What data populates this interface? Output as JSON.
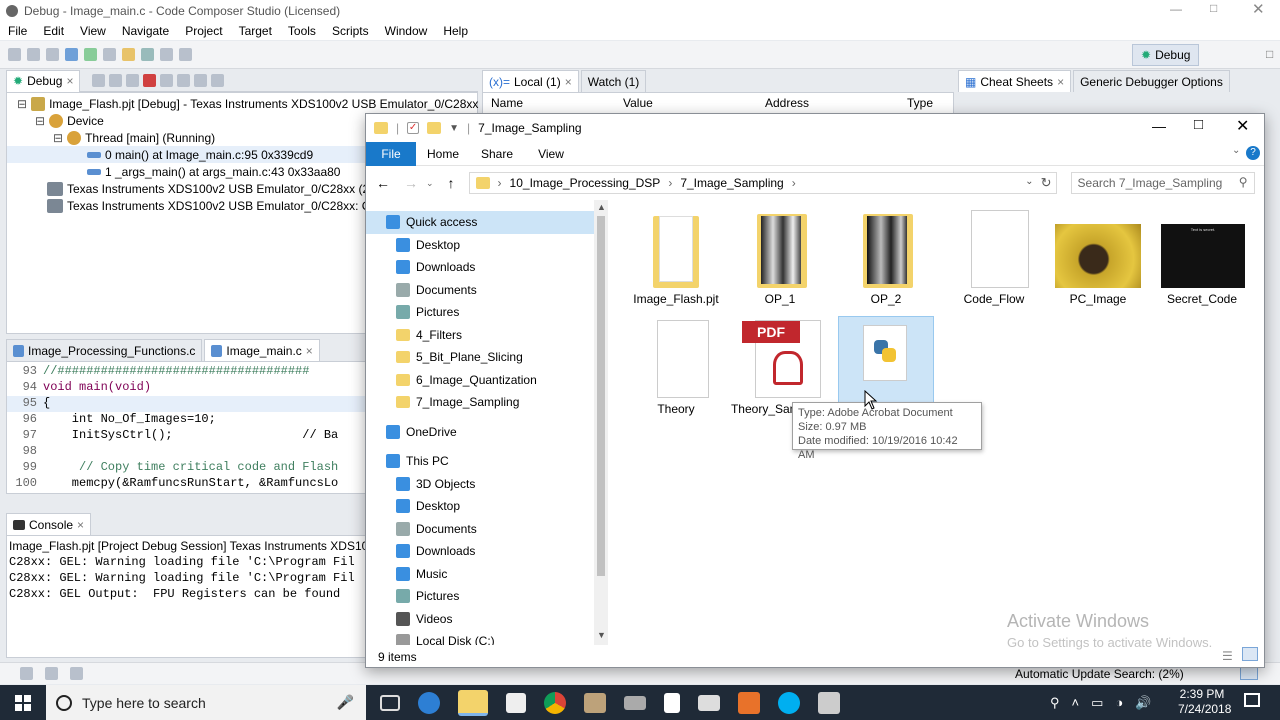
{
  "ccs": {
    "title": "Debug - Image_main.c - Code Composer Studio (Licensed)",
    "menu": [
      "File",
      "Edit",
      "View",
      "Navigate",
      "Project",
      "Target",
      "Tools",
      "Scripts",
      "Window",
      "Help"
    ],
    "perspective": "Debug",
    "debug_view": {
      "tab": "Debug",
      "tree": [
        "Image_Flash.pjt [Debug] - Texas Instruments XDS100v2 USB Emulator_0/C28xx [Project",
        "Device",
        "Thread [main] (Running)",
        "0 main() at Image_main.c:95 0x339cd9",
        "1 _args_main() at args_main.c:43 0x33aa80",
        "Texas Instruments XDS100v2 USB Emulator_0/C28xx (2:38:26 I",
        "Texas Instruments XDS100v2 USB Emulator_0/C28xx: CIO (2:3"
      ]
    },
    "variables_view": {
      "tabs": [
        "Local (1)",
        "Watch (1)"
      ],
      "columns": [
        "Name",
        "Value",
        "Address",
        "Type"
      ]
    },
    "right_view": {
      "tabs": [
        "Cheat Sheets",
        "Generic Debugger Options"
      ]
    },
    "editor": {
      "tabs": [
        "Image_Processing_Functions.c",
        "Image_main.c"
      ],
      "lines": [
        {
          "num": "93",
          "text": "//###################################"
        },
        {
          "num": "94",
          "text": "void main(void)"
        },
        {
          "num": "95",
          "text": "{"
        },
        {
          "num": "96",
          "text": "    int No_Of_Images=10;"
        },
        {
          "num": "97",
          "text": "    InitSysCtrl();                  // Ba"
        },
        {
          "num": "98",
          "text": ""
        },
        {
          "num": "99",
          "text": "     // Copy time critical code and Flash"
        },
        {
          "num": "100",
          "text": "    memcpy(&RamfuncsRunStart, &RamfuncsLo"
        }
      ]
    },
    "console": {
      "tab": "Console",
      "lines": [
        "Image_Flash.pjt [Project Debug Session] Texas Instruments XDS100v2 USB",
        "C28xx: GEL: Warning loading file 'C:\\Program Fil",
        "C28xx: GEL: Warning loading file 'C:\\Program Fil",
        "C28xx: GEL Output:  FPU Registers can be found "
      ]
    },
    "status": "Automatic Update Search: (2%)"
  },
  "explorer": {
    "title": "7_Image_Sampling",
    "ribbon_tabs": [
      "File",
      "Home",
      "Share",
      "View"
    ],
    "breadcrumb": [
      "10_Image_Processing_DSP",
      "7_Image_Sampling"
    ],
    "search_placeholder": "Search 7_Image_Sampling",
    "nav": [
      {
        "label": "Quick access",
        "icon": "star-icon",
        "pinned": false,
        "level": 0
      },
      {
        "label": "Desktop",
        "icon": "desktop-icon",
        "pinned": true,
        "level": 1
      },
      {
        "label": "Downloads",
        "icon": "download-icon",
        "pinned": true,
        "level": 1
      },
      {
        "label": "Documents",
        "icon": "document-icon",
        "pinned": true,
        "level": 1
      },
      {
        "label": "Pictures",
        "icon": "pictures-icon",
        "pinned": true,
        "level": 1
      },
      {
        "label": "4_Filters",
        "icon": "folder-icon",
        "pinned": false,
        "level": 1
      },
      {
        "label": "5_Bit_Plane_Slicing",
        "icon": "folder-icon",
        "pinned": false,
        "level": 1
      },
      {
        "label": "6_Image_Quantization",
        "icon": "folder-icon",
        "pinned": false,
        "level": 1
      },
      {
        "label": "7_Image_Sampling",
        "icon": "folder-icon",
        "pinned": false,
        "level": 1
      },
      {
        "label": "OneDrive",
        "icon": "cloud-icon",
        "pinned": false,
        "level": 0
      },
      {
        "label": "This PC",
        "icon": "computer-icon",
        "pinned": false,
        "level": 0
      },
      {
        "label": "3D Objects",
        "icon": "cube-icon",
        "pinned": false,
        "level": 1
      },
      {
        "label": "Desktop",
        "icon": "desktop-icon",
        "pinned": false,
        "level": 1
      },
      {
        "label": "Documents",
        "icon": "document-icon",
        "pinned": false,
        "level": 1
      },
      {
        "label": "Downloads",
        "icon": "download-icon",
        "pinned": false,
        "level": 1
      },
      {
        "label": "Music",
        "icon": "music-icon",
        "pinned": false,
        "level": 1
      },
      {
        "label": "Pictures",
        "icon": "pictures-icon",
        "pinned": false,
        "level": 1
      },
      {
        "label": "Videos",
        "icon": "video-icon",
        "pinned": false,
        "level": 1
      },
      {
        "label": "Local Disk (C:)",
        "icon": "disk-icon",
        "pinned": false,
        "level": 1
      }
    ],
    "files": [
      {
        "name": "Image_Flash.pjt",
        "kind": "folder-doc"
      },
      {
        "name": "OP_1",
        "kind": "folder-img"
      },
      {
        "name": "OP_2",
        "kind": "folder-img"
      },
      {
        "name": "Code_Flow",
        "kind": "doc"
      },
      {
        "name": "PC_Image",
        "kind": "photo"
      },
      {
        "name": "Secret_Code",
        "kind": "text-img"
      },
      {
        "name": "Theory",
        "kind": "doc"
      },
      {
        "name": "Theory_Sampling",
        "kind": "pdf"
      },
      {
        "name": "",
        "kind": "python"
      }
    ],
    "tooltip": {
      "type": "Type: Adobe Acrobat Document",
      "size": "Size: 0.97 MB",
      "date": "Date modified: 10/19/2016 10:42 AM"
    },
    "status": "9 items",
    "secret_text": "Text is secret."
  },
  "watermark": {
    "line1": "Activate Windows",
    "line2": "Go to Settings to activate Windows."
  },
  "taskbar": {
    "search_placeholder": "Type here to search",
    "time": "2:39 PM",
    "date": "7/24/2018"
  },
  "colors": {
    "accent": "#1979ca",
    "folder": "#f3d36b",
    "pdf": "#c1272d",
    "taskbar": "#1f2a37"
  }
}
